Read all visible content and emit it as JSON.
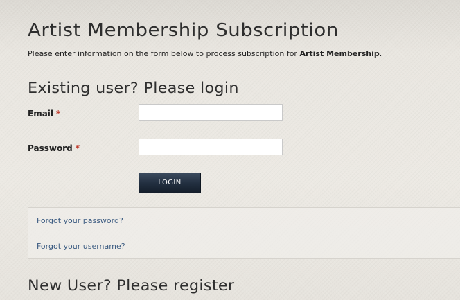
{
  "page": {
    "title": "Artist Membership Subscription",
    "intro_prefix": "Please enter information on the form below to process subscription for ",
    "intro_bold": "Artist Membership",
    "intro_suffix": "."
  },
  "login": {
    "heading": "Existing user? Please login",
    "email_label": "Email",
    "password_label": "Password",
    "required_marker": "*",
    "email_value": "",
    "password_value": "",
    "button_label": "LOGIN"
  },
  "links": {
    "forgot_password": "Forgot your password?",
    "forgot_username": "Forgot your username?"
  },
  "register": {
    "heading": "New User? Please register"
  },
  "colors": {
    "required": "#c0392b",
    "link": "#3a5a80",
    "button": "#233041"
  }
}
